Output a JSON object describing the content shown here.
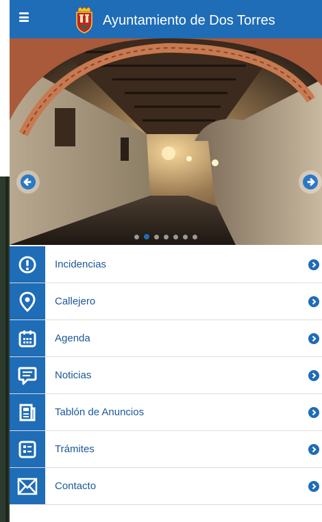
{
  "header": {
    "title": "Ayuntamiento de Dos Torres",
    "menu_icon": "hamburger-menu-icon",
    "crest_icon": "coat-of-arms-icon"
  },
  "slider": {
    "image_description": "arched stone portico corridor",
    "slide_count": 7,
    "active_slide": 2,
    "left_icon": "arrow-left-icon",
    "right_icon": "arrow-right-icon"
  },
  "menu": {
    "items": [
      {
        "label": "Incidencias",
        "icon": "exclamation-circle-icon"
      },
      {
        "label": "Callejero",
        "icon": "map-pin-icon"
      },
      {
        "label": "Agenda",
        "icon": "calendar-icon"
      },
      {
        "label": "Noticias",
        "icon": "speech-bubble-icon"
      },
      {
        "label": "Tablón de Anuncios",
        "icon": "newspaper-icon"
      },
      {
        "label": "Trámites",
        "icon": "form-icon"
      },
      {
        "label": "Contacto",
        "icon": "envelope-icon"
      }
    ],
    "chevron_icon": "chevron-right-icon"
  },
  "colors": {
    "accent": "#1f6cb7",
    "label": "#1a5799",
    "divider": "#dcdcdc"
  }
}
